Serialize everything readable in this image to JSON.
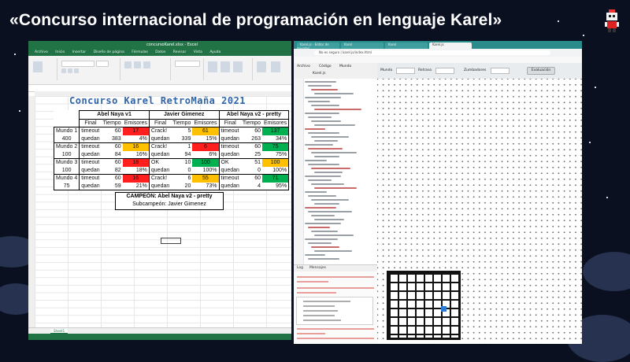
{
  "slide": {
    "title": "«Concurso internacional de programación en lenguaje Karel»"
  },
  "excel": {
    "window_title": "concursoKarel.xlsx - Excel",
    "menu": [
      "Archivo",
      "Inicio",
      "Insertar",
      "Diseño de página",
      "Fórmulas",
      "Datos",
      "Revisar",
      "Vista",
      "Ayuda",
      "Easy Document Creator",
      "ACROBAT",
      "¿Qué desea hacer?",
      "Compartir"
    ],
    "sheet_title": "Concurso Karel   RetroMaña 2021",
    "participants": [
      "Abel Naya v1",
      "Javier Gimenez",
      "Abel Naya v2 - pretty"
    ],
    "subheaders": [
      "Final",
      "Tiempo",
      "Emisores"
    ],
    "rows": [
      {
        "label": "Mundo 1",
        "sub": "400",
        "cells": [
          {
            "final": "timeout",
            "tiempo": "60",
            "emisores": "17",
            "emisores_color": "red"
          },
          {
            "final": "Crack!",
            "tiempo": "5",
            "emisores": "61",
            "emisores_color": "orange"
          },
          {
            "final": "timeout",
            "tiempo": "60",
            "emisores": "137",
            "emisores_color": "green"
          }
        ],
        "sub_cells": [
          {
            "final": "quedan",
            "tiempo": "383",
            "emisores": "4%"
          },
          {
            "final": "quedan",
            "tiempo": "339",
            "emisores": "15%"
          },
          {
            "final": "quedan",
            "tiempo": "263",
            "emisores": "34%"
          }
        ]
      },
      {
        "label": "Mundo 2",
        "sub": "100",
        "cells": [
          {
            "final": "timeout",
            "tiempo": "60",
            "emisores": "16",
            "emisores_color": "orange"
          },
          {
            "final": "Crack!",
            "tiempo": "1",
            "emisores": "6",
            "emisores_color": "red"
          },
          {
            "final": "timeout",
            "tiempo": "60",
            "emisores": "75",
            "emisores_color": "green"
          }
        ],
        "sub_cells": [
          {
            "final": "quedan",
            "tiempo": "84",
            "emisores": "16%"
          },
          {
            "final": "quedan",
            "tiempo": "94",
            "emisores": "6%"
          },
          {
            "final": "quedan",
            "tiempo": "25",
            "emisores": "75%"
          }
        ]
      },
      {
        "label": "Mundo 3",
        "sub": "100",
        "cells": [
          {
            "final": "timeout",
            "tiempo": "60",
            "emisores": "18",
            "emisores_color": "red"
          },
          {
            "final": "OK",
            "tiempo": "10",
            "emisores": "100",
            "emisores_color": "green"
          },
          {
            "final": "OK",
            "tiempo": "51",
            "emisores": "100",
            "emisores_color": "orange"
          }
        ],
        "sub_cells": [
          {
            "final": "quedan",
            "tiempo": "82",
            "emisores": "18%"
          },
          {
            "final": "quedan",
            "tiempo": "0",
            "emisores": "100%"
          },
          {
            "final": "quedan",
            "tiempo": "0",
            "emisores": "100%"
          }
        ]
      },
      {
        "label": "Mundo 4",
        "sub": "75",
        "cells": [
          {
            "final": "timeout",
            "tiempo": "60",
            "emisores": "16",
            "emisores_color": "red"
          },
          {
            "final": "Crack!",
            "tiempo": "6",
            "emisores": "55",
            "emisores_color": "orange"
          },
          {
            "final": "timeout",
            "tiempo": "60",
            "emisores": "71",
            "emisores_color": "green"
          }
        ],
        "sub_cells": [
          {
            "final": "quedan",
            "tiempo": "59",
            "emisores": "21%"
          },
          {
            "final": "quedan",
            "tiempo": "20",
            "emisores": "73%"
          },
          {
            "final": "quedan",
            "tiempo": "4",
            "emisores": "95%"
          }
        ]
      }
    ],
    "champion": "CAMPEÓN: Abel Naya v2 - pretty",
    "runner_up": "Subcampeón: Javier Gimenez",
    "sheet_tab": "Sheet1"
  },
  "browser": {
    "tabs": [
      "Karel.js - Editor de mundos",
      "Karel",
      "Karel",
      "Karel.js"
    ],
    "url": "No es seguro | karel.js/index.html",
    "ide_menu": [
      "Archivo",
      "Código",
      "Mundo"
    ],
    "language": "Karel.js",
    "toolbar": {
      "speed_label": "Retraso",
      "world_label": "Mundo",
      "beepers_label": "Zumbadores",
      "eval_label": "Evaluación"
    },
    "console_tabs": [
      "Log",
      "Mensajes"
    ],
    "robot_color": "#2e7bd6"
  },
  "colors": {
    "red": "#ff1f1f",
    "orange": "#ffc000",
    "green": "#00b050",
    "excel_green": "#217346",
    "title_blue": "#2f64a8"
  }
}
